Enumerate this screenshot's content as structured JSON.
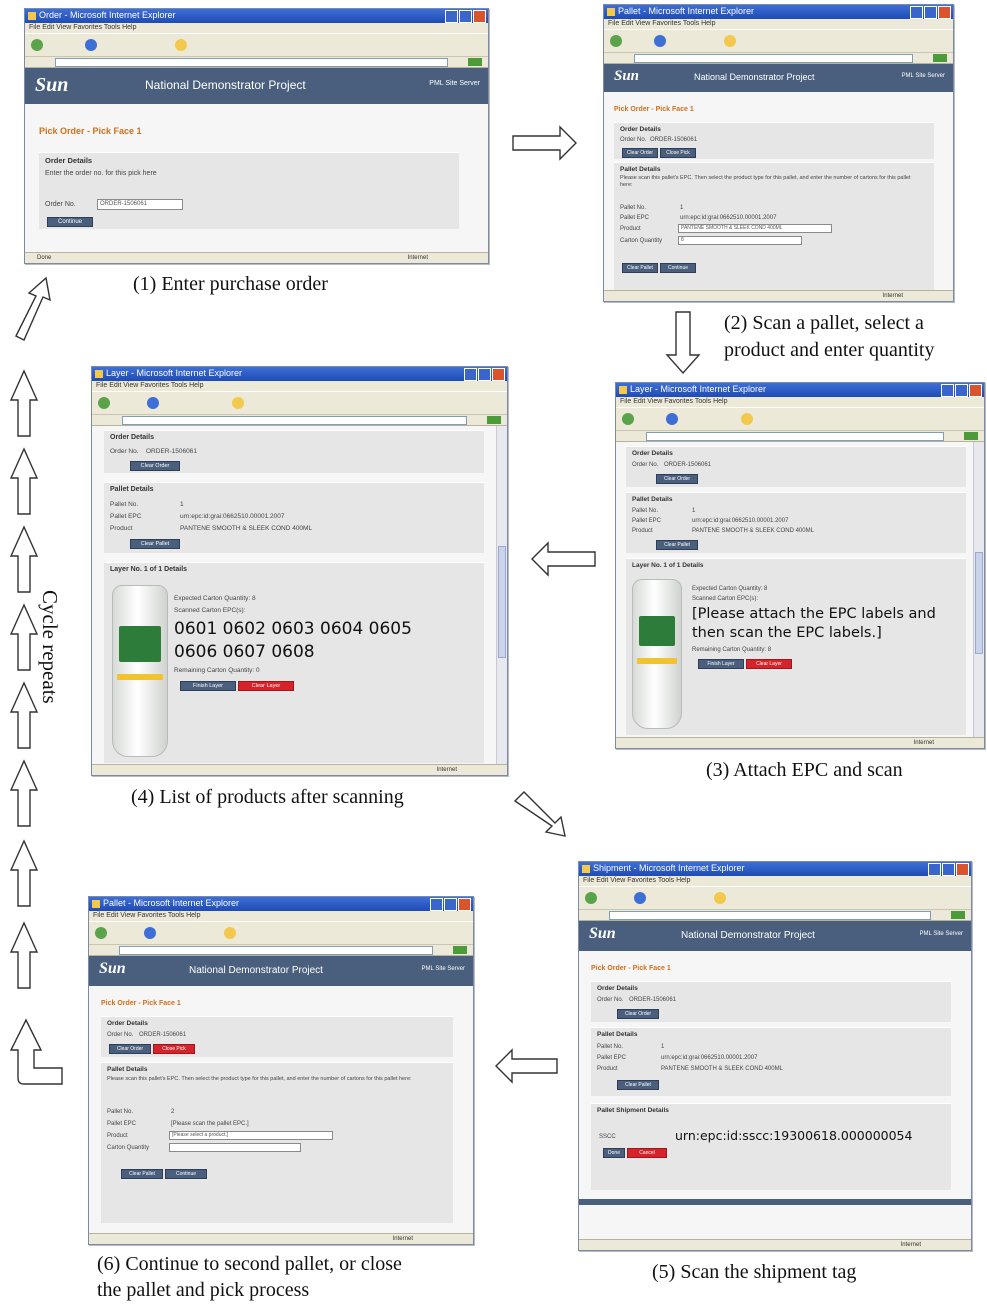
{
  "captions": {
    "step1": "(1) Enter purchase order",
    "step2_line1": "(2) Scan a pallet, select a",
    "step2_line2": "product and enter quantity",
    "step3": "(3) Attach EPC and scan",
    "step4": "(4) List of products after scanning",
    "step5": "(5) Scan the shipment tag",
    "step6_line1": "(6) Continue to second pallet, or close",
    "step6_line2": "the pallet and pick process",
    "cycle": "Cycle repeats"
  },
  "common": {
    "menu": "File   Edit   View   Favorites   Tools   Help",
    "logo": "Sun",
    "project": "National Demonstrator Project",
    "banner_right": "PML Site Server",
    "page_title": "Pick Order - Pick Face 1",
    "order_details": "Order Details",
    "order_no_label": "Order No.",
    "order_no": "ORDER-1506061",
    "pallet_details": "Pallet Details",
    "pallet_no_label": "Pallet No.",
    "pallet_epc_label": "Pallet EPC",
    "product_label": "Product",
    "carton_qty_label": "Carton Quantity",
    "pallet_no": "1",
    "pallet_epc": "urn:epc:id:grai:0662510.00001.2007",
    "product": "PANTENE SMOOTH & SLEEK COND 400ML",
    "status_internet": "Internet",
    "status_done": "Done"
  },
  "win1": {
    "title": "Order - Microsoft Internet Explorer",
    "enter_hint": "Enter the order no. for this pick here",
    "continue_btn": "Continue"
  },
  "win2": {
    "title": "Pallet - Microsoft Internet Explorer",
    "clear_order": "Clear Order",
    "close_pick": "Close Pick",
    "pallet_hint": "Please scan this pallet's EPC. Then select the product type for this pallet, and enter the number of cartons for this pallet here:",
    "carton_qty": "8",
    "clear_pallet": "Clear Pallet",
    "continue_btn": "Continue"
  },
  "win3": {
    "title": "Layer - Microsoft Internet Explorer",
    "layer_heading": "Layer No. 1 of 1 Details",
    "expected": "Expected Carton Quantity: 8",
    "scanned": "Scanned Carton EPC(s):",
    "attach_line1": "[Please attach the EPC labels and",
    "attach_line2": "then scan the EPC labels.]",
    "remaining": "Remaining Carton Quantity: 8",
    "finish_layer": "Finish Layer",
    "clear_layer": "Clear Layer",
    "clear_pallet": "Clear Pallet",
    "clear_order": "Clear Order"
  },
  "win4": {
    "title": "Layer - Microsoft Internet Explorer",
    "layer_heading": "Layer No. 1 of 1 Details",
    "expected": "Expected Carton Quantity: 8",
    "scanned": "Scanned Carton EPC(s):",
    "epcs_line1": "0601  0602  0603  0604  0605",
    "epcs_line2": "0606  0607  0608",
    "remaining": "Remaining Carton Quantity: 0",
    "finish_layer": "Finish Layer",
    "clear_layer": "Clear Layer",
    "clear_pallet": "Clear Pallet",
    "clear_order": "Clear Order"
  },
  "win5": {
    "title": "Shipment - Microsoft Internet Explorer",
    "shipment_heading": "Pallet Shipment Details",
    "sscc_label": "SSCC",
    "sscc_value": "urn:epc:id:sscc:19300618.000000054",
    "clear_order": "Clear Order",
    "clear_pallet": "Clear Pallet",
    "done_btn": "Done",
    "cancel_btn": "Cancel"
  },
  "win6": {
    "title": "Pallet - Microsoft Internet Explorer",
    "clear_order": "Clear Order",
    "close_pick": "Close Pick",
    "pallet_hint": "Please scan this pallet's EPC. Then select the product type for this pallet, and enter the number of cartons for this pallet here:",
    "pallet_no": "2",
    "pallet_epc_prompt": "[Please scan the pallet EPC.]",
    "product_prompt": "[Please select a product.]",
    "clear_pallet": "Clear Pallet",
    "continue_btn": "Continue"
  }
}
